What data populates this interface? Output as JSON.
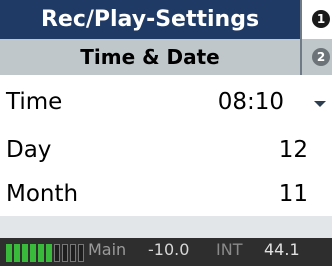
{
  "header": {
    "title": "Rec/Play-Settings",
    "subtitle": "Time & Date"
  },
  "side_indicators": {
    "one": "1",
    "two": "2"
  },
  "rows": [
    {
      "label": "Time",
      "value": "08:10"
    },
    {
      "label": "Day",
      "value": "12"
    },
    {
      "label": "Month",
      "value": "11"
    }
  ],
  "status": {
    "source_label": "Main",
    "source_value": "-10.0",
    "clock_label": "INT",
    "clock_value": "44.1",
    "meter_level_segments": 6
  },
  "colors": {
    "title_bg": "#1f3a64",
    "subtitle_bg": "#c0c7cb",
    "status_bg": "#2e2e2e",
    "meter_green": "#3aba3a"
  },
  "icons": {
    "dropdown": "chevron-down-icon"
  }
}
